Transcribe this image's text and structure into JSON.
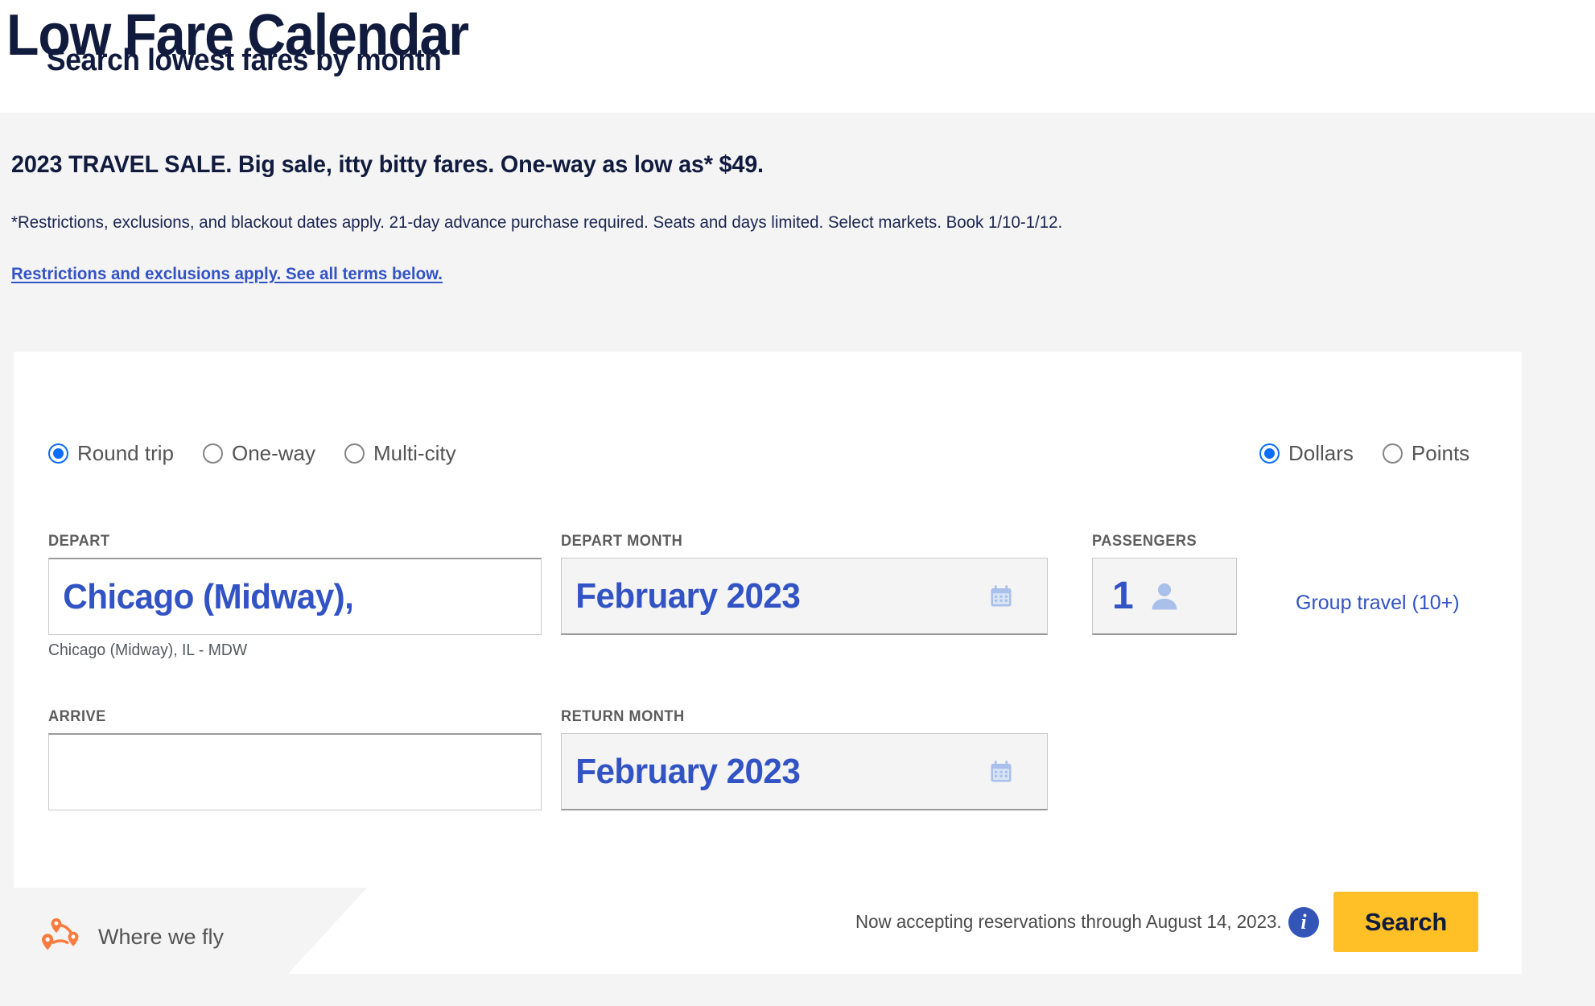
{
  "page": {
    "title": "Low Fare Calendar"
  },
  "promo": {
    "headline": "2023 TRAVEL SALE. Big sale, itty bitty fares. One-way as low as* $49.",
    "fine_print": "*Restrictions, exclusions, and blackout dates apply. 21-day advance purchase required. Seats and days limited. Select markets. Book 1/10-1/12.",
    "terms_link": "Restrictions and exclusions apply. See all terms below."
  },
  "search_card": {
    "title": "Search lowest fares by month",
    "trip_type": {
      "selected": "Round trip",
      "options": [
        {
          "label": "Round trip",
          "checked": true
        },
        {
          "label": "One-way",
          "checked": false
        },
        {
          "label": "Multi-city",
          "checked": false
        }
      ]
    },
    "currency": {
      "selected": "Dollars",
      "options": [
        {
          "label": "Dollars",
          "checked": true
        },
        {
          "label": "Points",
          "checked": false
        }
      ]
    },
    "fields": {
      "depart": {
        "label": "DEPART",
        "value": "Chicago (Midway),",
        "placeholder": "",
        "helper": "Chicago (Midway), IL - MDW"
      },
      "depart_month": {
        "label": "DEPART MONTH",
        "value": "February 2023",
        "icon": "calendar-icon"
      },
      "passengers": {
        "label": "PASSENGERS",
        "value": "1",
        "icon": "person-icon"
      },
      "arrive": {
        "label": "ARRIVE",
        "value": "",
        "placeholder": ""
      },
      "return_month": {
        "label": "RETURN MONTH",
        "value": "February 2023",
        "icon": "calendar-icon"
      }
    },
    "group_travel_link": "Group travel (10+)",
    "footer": {
      "where_we_fly": "Where we fly",
      "where_we_fly_icon": "map-pins-icon",
      "accepting_notice": "Now accepting reservations through August 14, 2023.",
      "info_icon": "info-circle-icon",
      "search_button": "Search"
    }
  },
  "colors": {
    "brand_navy": "#111b3e",
    "brand_blue": "#3253c4",
    "radio_blue": "#0d6efd",
    "accent_yellow": "#ffbf27",
    "accent_orange": "#f97b3e",
    "page_gray": "#f4f4f4",
    "icon_light_blue": "#a9c0ea"
  }
}
